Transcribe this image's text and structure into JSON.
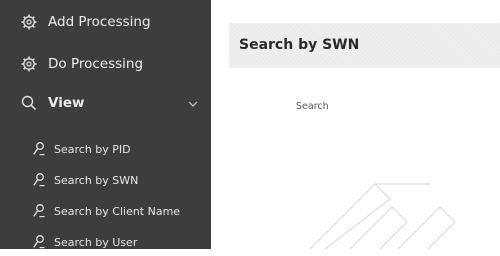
{
  "sidebar": {
    "items": [
      {
        "label": "Add Processing",
        "icon": "gear-icon"
      },
      {
        "label": "Do Processing",
        "icon": "gear-icon"
      },
      {
        "label": "View",
        "icon": "search-icon",
        "expanded": true
      }
    ],
    "subitems": [
      {
        "label": "Search by PID",
        "icon": "user-search-icon"
      },
      {
        "label": "Search by SWN",
        "icon": "user-search-icon"
      },
      {
        "label": "Search by Client Name",
        "icon": "user-search-icon"
      },
      {
        "label": "Search by User",
        "icon": "user-search-icon"
      }
    ]
  },
  "main": {
    "title": "Search by SWN",
    "search_button_label": "Search"
  },
  "colors": {
    "sidebar_bg": "#3d3d3d",
    "sidebar_text": "#ececec",
    "header_bg": "#efefef"
  }
}
